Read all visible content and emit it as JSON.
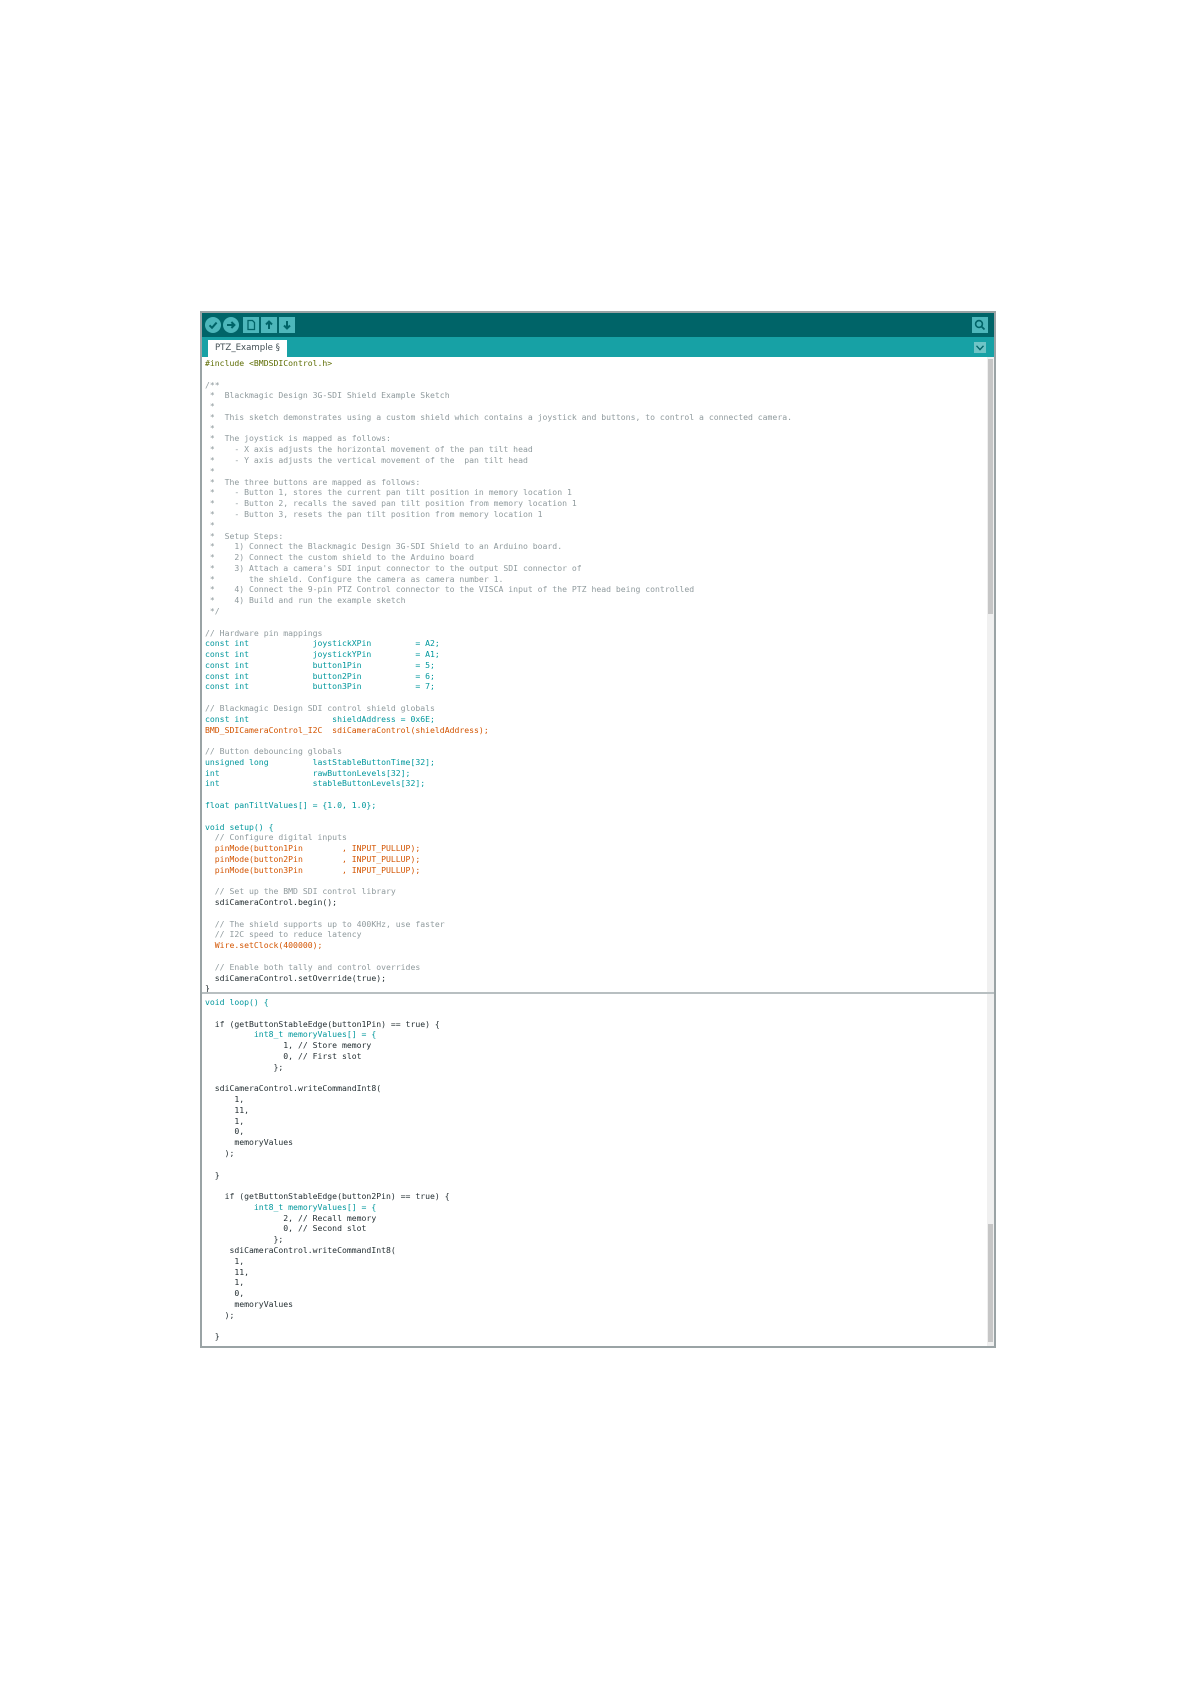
{
  "toolbar": {
    "buttons": [
      {
        "name": "verify",
        "icon": "checkmark-icon"
      },
      {
        "name": "upload",
        "icon": "arrow-right-icon"
      },
      {
        "name": "new",
        "icon": "new-file-icon"
      },
      {
        "name": "open",
        "icon": "arrow-up-icon"
      },
      {
        "name": "save",
        "icon": "arrow-down-icon"
      }
    ],
    "serial_monitor_icon": "magnifier-icon"
  },
  "tab": {
    "label": "PTZ_Example §"
  },
  "editor": {
    "top": [
      {
        "t": "#include <BMDSDIControl.h>",
        "c": "pp"
      },
      {
        "t": "",
        "c": "tx"
      },
      {
        "t": "/**",
        "c": "cm"
      },
      {
        "t": " *  Blackmagic Design 3G-SDI Shield Example Sketch",
        "c": "cm"
      },
      {
        "t": " *",
        "c": "cm"
      },
      {
        "t": " *  This sketch demonstrates using a custom shield which contains a joystick and buttons, to control a connected camera.",
        "c": "cm"
      },
      {
        "t": " *",
        "c": "cm"
      },
      {
        "t": " *  The joystick is mapped as follows:",
        "c": "cm"
      },
      {
        "t": " *    - X axis adjusts the horizontal movement of the pan tilt head",
        "c": "cm"
      },
      {
        "t": " *    - Y axis adjusts the vertical movement of the  pan tilt head",
        "c": "cm"
      },
      {
        "t": " *",
        "c": "cm"
      },
      {
        "t": " *  The three buttons are mapped as follows:",
        "c": "cm"
      },
      {
        "t": " *    - Button 1, stores the current pan tilt position in memory location 1",
        "c": "cm"
      },
      {
        "t": " *    - Button 2, recalls the saved pan tilt position from memory location 1",
        "c": "cm"
      },
      {
        "t": " *    - Button 3, resets the pan tilt position from memory location 1",
        "c": "cm"
      },
      {
        "t": " *",
        "c": "cm"
      },
      {
        "t": " *  Setup Steps:",
        "c": "cm"
      },
      {
        "t": " *    1) Connect the Blackmagic Design 3G-SDI Shield to an Arduino board.",
        "c": "cm"
      },
      {
        "t": " *    2) Connect the custom shield to the Arduino board",
        "c": "cm"
      },
      {
        "t": " *    3) Attach a camera's SDI input connector to the output SDI connector of",
        "c": "cm"
      },
      {
        "t": " *       the shield. Configure the camera as camera number 1.",
        "c": "cm"
      },
      {
        "t": " *    4) Connect the 9-pin PTZ Control connector to the VISCA input of the PTZ head being controlled",
        "c": "cm"
      },
      {
        "t": " *    4) Build and run the example sketch",
        "c": "cm"
      },
      {
        "t": " */",
        "c": "cm"
      },
      {
        "t": "",
        "c": "tx"
      },
      {
        "t": "// Hardware pin mappings",
        "c": "cm"
      },
      {
        "t": "const int             joystickXPin         = A2;",
        "c": "kw"
      },
      {
        "t": "const int             joystickYPin         = A1;",
        "c": "kw"
      },
      {
        "t": "const int             button1Pin           = 5;",
        "c": "kw"
      },
      {
        "t": "const int             button2Pin           = 6;",
        "c": "kw"
      },
      {
        "t": "const int             button3Pin           = 7;",
        "c": "kw"
      },
      {
        "t": "",
        "c": "tx"
      },
      {
        "t": "// Blackmagic Design SDI control shield globals",
        "c": "cm"
      },
      {
        "t": "const int                 shieldAddress = 0x6E;",
        "c": "kw"
      },
      {
        "t": "BMD_SDICameraControl_I2C  sdiCameraControl(shieldAddress);",
        "c": "fn"
      },
      {
        "t": "",
        "c": "tx"
      },
      {
        "t": "// Button debouncing globals",
        "c": "cm"
      },
      {
        "t": "unsigned long         lastStableButtonTime[32];",
        "c": "kw"
      },
      {
        "t": "int                   rawButtonLevels[32];",
        "c": "kw"
      },
      {
        "t": "int                   stableButtonLevels[32];",
        "c": "kw"
      },
      {
        "t": "",
        "c": "tx"
      },
      {
        "t": "float panTiltValues[] = {1.0, 1.0};",
        "c": "kw"
      },
      {
        "t": "",
        "c": "tx"
      },
      {
        "t": "void setup() {",
        "c": "kw"
      },
      {
        "t": "  // Configure digital inputs",
        "c": "cm"
      },
      {
        "t": "  pinMode(button1Pin        , INPUT_PULLUP);",
        "c": "fn"
      },
      {
        "t": "  pinMode(button2Pin        , INPUT_PULLUP);",
        "c": "fn"
      },
      {
        "t": "  pinMode(button3Pin        , INPUT_PULLUP);",
        "c": "fn"
      },
      {
        "t": "",
        "c": "tx"
      },
      {
        "t": "  // Set up the BMD SDI control library",
        "c": "cm"
      },
      {
        "t": "  sdiCameraControl.begin();",
        "c": "tx"
      },
      {
        "t": "",
        "c": "tx"
      },
      {
        "t": "  // The shield supports up to 400KHz, use faster",
        "c": "cm"
      },
      {
        "t": "  // I2C speed to reduce latency",
        "c": "cm"
      },
      {
        "t": "  Wire.setClock(400000);",
        "c": "fn"
      },
      {
        "t": "",
        "c": "tx"
      },
      {
        "t": "  // Enable both tally and control overrides",
        "c": "cm"
      },
      {
        "t": "  sdiCameraControl.setOverride(true);",
        "c": "tx"
      },
      {
        "t": "}",
        "c": "tx"
      }
    ],
    "bottom": [
      {
        "t": "void loop() {",
        "c": "kw"
      },
      {
        "t": "",
        "c": "tx"
      },
      {
        "t": "  if (getButtonStableEdge(button1Pin) == true) {",
        "c": "tx"
      },
      {
        "t": "          int8_t memoryValues[] = {",
        "c": "kw"
      },
      {
        "t": "                1, // Store memory",
        "c": "tx"
      },
      {
        "t": "                0, // First slot",
        "c": "tx"
      },
      {
        "t": "              };",
        "c": "tx"
      },
      {
        "t": "",
        "c": "tx"
      },
      {
        "t": "  sdiCameraControl.writeCommandInt8(",
        "c": "tx"
      },
      {
        "t": "      1,",
        "c": "tx"
      },
      {
        "t": "      11,",
        "c": "tx"
      },
      {
        "t": "      1,",
        "c": "tx"
      },
      {
        "t": "      0,",
        "c": "tx"
      },
      {
        "t": "      memoryValues",
        "c": "tx"
      },
      {
        "t": "    );",
        "c": "tx"
      },
      {
        "t": "",
        "c": "tx"
      },
      {
        "t": "  }",
        "c": "tx"
      },
      {
        "t": "",
        "c": "tx"
      },
      {
        "t": "    if (getButtonStableEdge(button2Pin) == true) {",
        "c": "tx"
      },
      {
        "t": "          int8_t memoryValues[] = {",
        "c": "kw"
      },
      {
        "t": "                2, // Recall memory",
        "c": "tx"
      },
      {
        "t": "                0, // Second slot",
        "c": "tx"
      },
      {
        "t": "              };",
        "c": "tx"
      },
      {
        "t": "     sdiCameraControl.writeCommandInt8(",
        "c": "tx"
      },
      {
        "t": "      1,",
        "c": "tx"
      },
      {
        "t": "      11,",
        "c": "tx"
      },
      {
        "t": "      1,",
        "c": "tx"
      },
      {
        "t": "      0,",
        "c": "tx"
      },
      {
        "t": "      memoryValues",
        "c": "tx"
      },
      {
        "t": "    );",
        "c": "tx"
      },
      {
        "t": "",
        "c": "tx"
      },
      {
        "t": "  }",
        "c": "tx"
      }
    ]
  },
  "colors": {
    "toolbar": "#006468",
    "tabbar": "#17a1a5",
    "keyword": "#00979c",
    "function": "#d35400",
    "comment": "#8f9a9d",
    "text": "#1f2a2e"
  }
}
